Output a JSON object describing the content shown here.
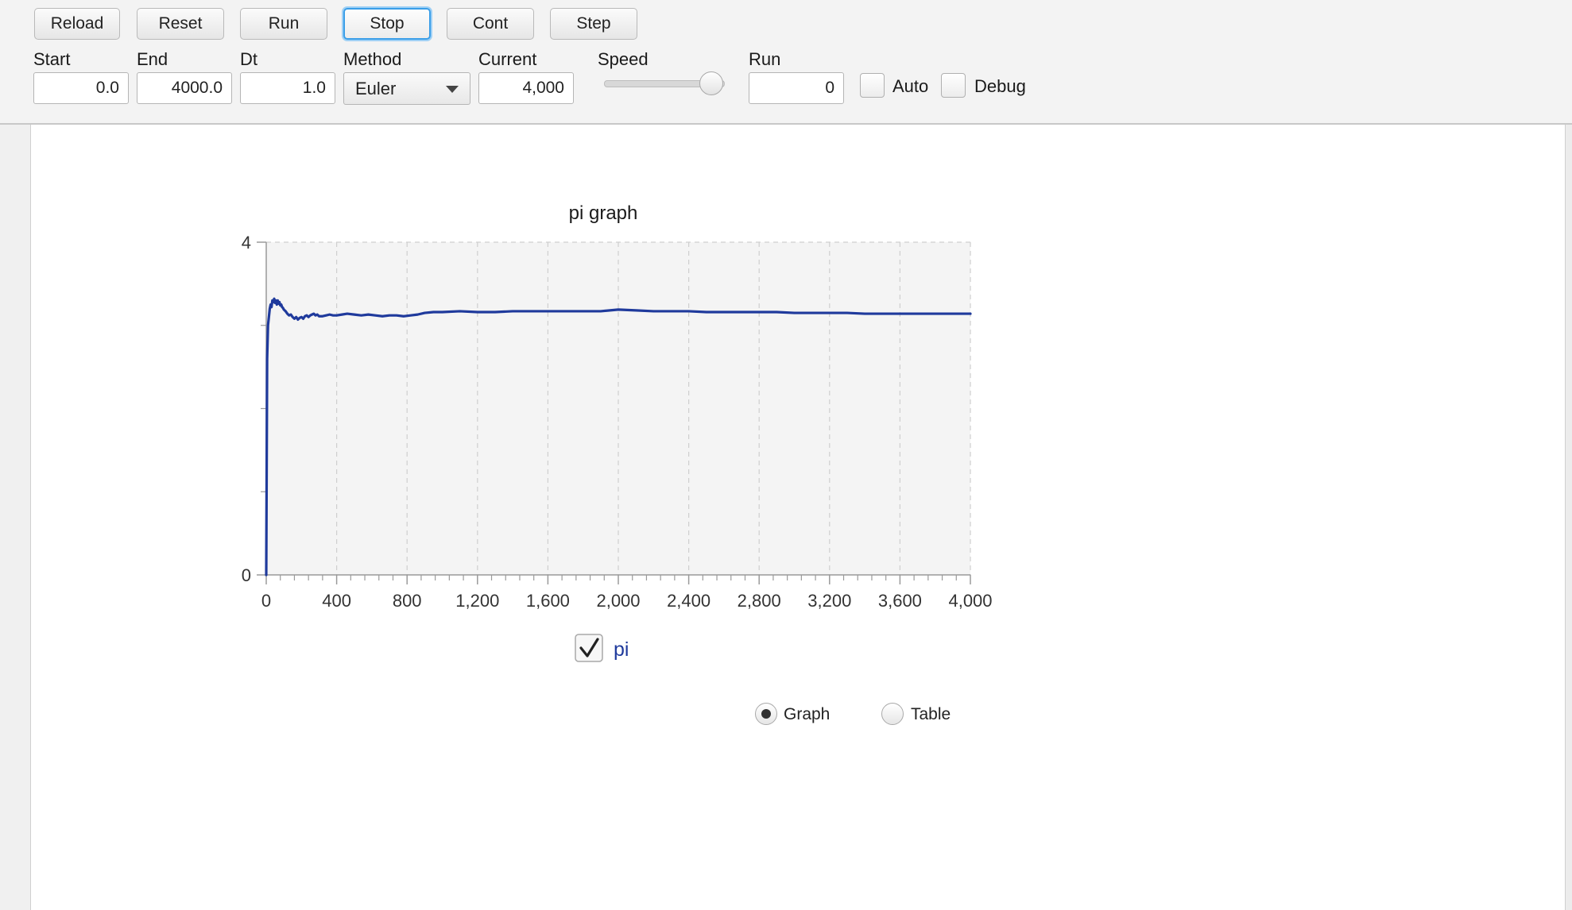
{
  "toolbar": {
    "buttons": [
      "Reload",
      "Reset",
      "Run",
      "Stop",
      "Cont",
      "Step"
    ],
    "focused_button": "Stop",
    "start_label": "Start",
    "start_value": "0.0",
    "end_label": "End",
    "end_value": "4000.0",
    "dt_label": "Dt",
    "dt_value": "1.0",
    "method_label": "Method",
    "method_value": "Euler",
    "current_label": "Current",
    "current_value": "4,000",
    "speed_label": "Speed",
    "speed_level": 1.0,
    "run_label": "Run",
    "run_value": "0",
    "auto_label": "Auto",
    "auto_checked": false,
    "debug_label": "Debug",
    "debug_checked": false
  },
  "chart_data": {
    "type": "line",
    "title": "pi graph",
    "xlabel": "",
    "ylabel": "",
    "xlim": [
      0,
      4000
    ],
    "ylim": [
      0,
      4
    ],
    "x_ticks": [
      "0",
      "400",
      "800",
      "1,200",
      "1,600",
      "2,000",
      "2,400",
      "2,800",
      "3,200",
      "3,600",
      "4,000"
    ],
    "y_ticks": [
      "0",
      "4"
    ],
    "grid": true,
    "legend_position": "bottom",
    "series": [
      {
        "name": "pi",
        "color": "#1f3a9c",
        "x": [
          0,
          5,
          10,
          15,
          20,
          25,
          30,
          35,
          40,
          45,
          50,
          55,
          60,
          65,
          70,
          75,
          80,
          85,
          90,
          95,
          100,
          110,
          120,
          130,
          140,
          150,
          160,
          170,
          180,
          190,
          200,
          210,
          220,
          230,
          240,
          250,
          260,
          270,
          280,
          290,
          300,
          320,
          340,
          360,
          380,
          400,
          430,
          460,
          500,
          540,
          580,
          620,
          660,
          700,
          740,
          780,
          820,
          860,
          900,
          950,
          1000,
          1100,
          1200,
          1300,
          1400,
          1500,
          1600,
          1700,
          1800,
          1900,
          2000,
          2100,
          2200,
          2300,
          2400,
          2500,
          2600,
          2700,
          2800,
          2900,
          3000,
          3100,
          3200,
          3300,
          3400,
          3500,
          3600,
          3700,
          3800,
          3900,
          4000
        ],
        "y": [
          0.0,
          2.6,
          3.0,
          3.1,
          3.2,
          3.25,
          3.22,
          3.3,
          3.28,
          3.32,
          3.27,
          3.3,
          3.25,
          3.3,
          3.26,
          3.28,
          3.24,
          3.25,
          3.22,
          3.21,
          3.19,
          3.17,
          3.14,
          3.12,
          3.13,
          3.1,
          3.08,
          3.1,
          3.07,
          3.09,
          3.1,
          3.08,
          3.11,
          3.12,
          3.1,
          3.12,
          3.13,
          3.14,
          3.12,
          3.13,
          3.11,
          3.11,
          3.12,
          3.13,
          3.12,
          3.12,
          3.13,
          3.14,
          3.13,
          3.12,
          3.13,
          3.12,
          3.11,
          3.12,
          3.12,
          3.11,
          3.12,
          3.13,
          3.15,
          3.16,
          3.16,
          3.17,
          3.16,
          3.16,
          3.17,
          3.17,
          3.17,
          3.17,
          3.17,
          3.17,
          3.19,
          3.18,
          3.17,
          3.17,
          3.17,
          3.16,
          3.16,
          3.16,
          3.16,
          3.16,
          3.15,
          3.15,
          3.15,
          3.15,
          3.14,
          3.14,
          3.14,
          3.14,
          3.14,
          3.14,
          3.14
        ]
      }
    ]
  },
  "legend": {
    "pi_label": "pi",
    "pi_checked": true
  },
  "view_toggle": {
    "graph_label": "Graph",
    "table_label": "Table",
    "selected": "Graph"
  }
}
